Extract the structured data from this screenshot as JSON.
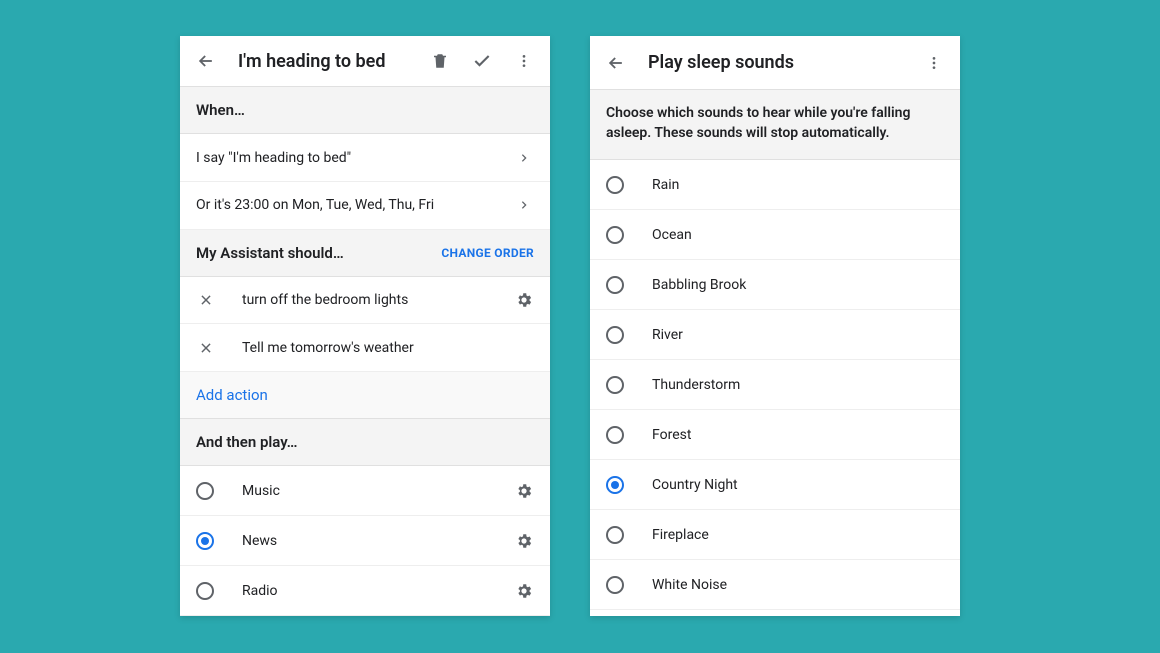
{
  "left": {
    "title": "I'm heading to bed",
    "sections": {
      "when": {
        "label": "When…",
        "items": [
          {
            "text": "I say \"I'm heading to bed\""
          },
          {
            "text": "Or it's 23:00 on Mon, Tue, Wed, Thu, Fri"
          }
        ]
      },
      "assistant": {
        "label": "My Assistant should…",
        "change_order": "CHANGE ORDER",
        "actions": [
          {
            "text": "turn off the bedroom lights",
            "has_gear": true
          },
          {
            "text": "Tell me tomorrow's weather",
            "has_gear": false
          }
        ],
        "add_action": "Add action"
      },
      "play": {
        "label": "And then play…",
        "options": [
          {
            "label": "Music",
            "selected": false
          },
          {
            "label": "News",
            "selected": true
          },
          {
            "label": "Radio",
            "selected": false
          }
        ]
      }
    }
  },
  "right": {
    "title": "Play sleep sounds",
    "description": "Choose which sounds to hear while you're falling asleep. These sounds will stop automatically.",
    "options": [
      {
        "label": "Rain",
        "selected": false
      },
      {
        "label": "Ocean",
        "selected": false
      },
      {
        "label": "Babbling Brook",
        "selected": false
      },
      {
        "label": "River",
        "selected": false
      },
      {
        "label": "Thunderstorm",
        "selected": false
      },
      {
        "label": "Forest",
        "selected": false
      },
      {
        "label": "Country Night",
        "selected": true
      },
      {
        "label": "Fireplace",
        "selected": false
      },
      {
        "label": "White Noise",
        "selected": false
      }
    ]
  }
}
